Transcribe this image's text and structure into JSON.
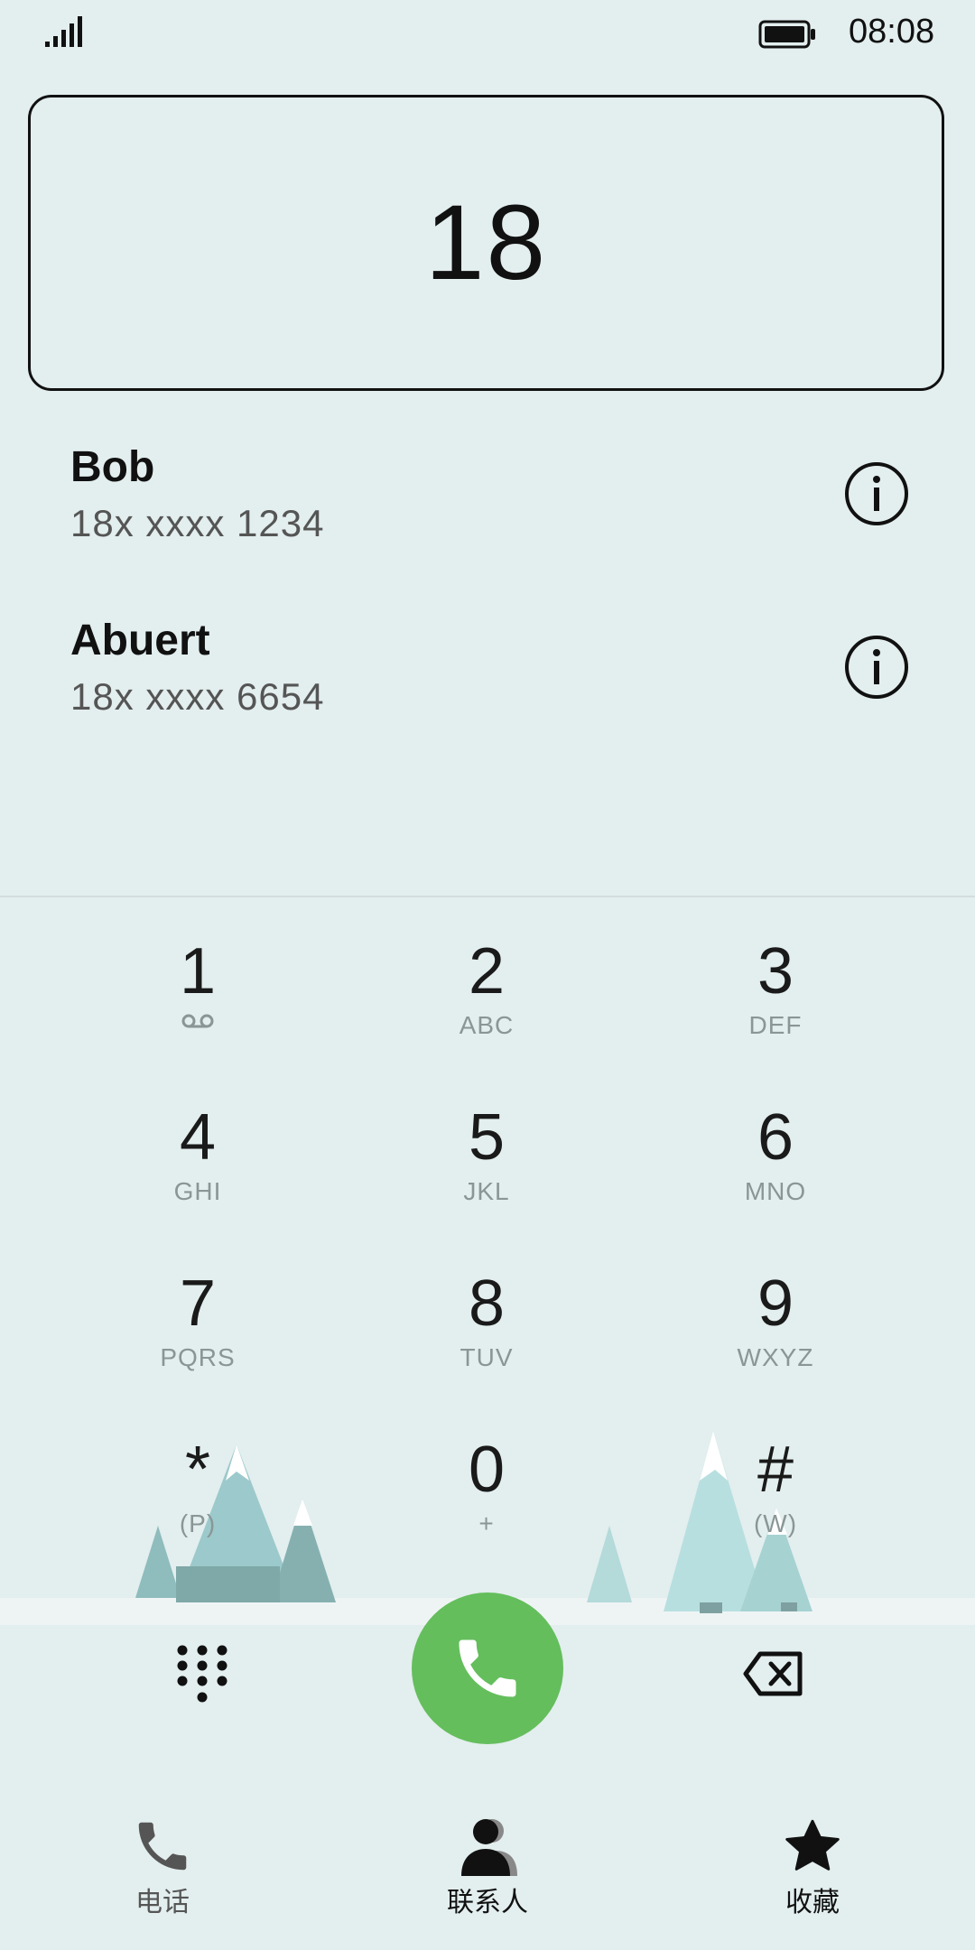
{
  "status_bar": {
    "time": "08:08"
  },
  "dialer": {
    "input": "18"
  },
  "suggestions": [
    {
      "name": "Bob",
      "number": "18x xxxx 1234"
    },
    {
      "name": "Abuert",
      "number": "18x xxxx 6654"
    }
  ],
  "keypad": [
    {
      "digit": "1",
      "sub": ""
    },
    {
      "digit": "2",
      "sub": "ABC"
    },
    {
      "digit": "3",
      "sub": "DEF"
    },
    {
      "digit": "4",
      "sub": "GHI"
    },
    {
      "digit": "5",
      "sub": "JKL"
    },
    {
      "digit": "6",
      "sub": "MNO"
    },
    {
      "digit": "7",
      "sub": "PQRS"
    },
    {
      "digit": "8",
      "sub": "TUV"
    },
    {
      "digit": "9",
      "sub": "WXYZ"
    },
    {
      "digit": "*",
      "sub": "(P)"
    },
    {
      "digit": "0",
      "sub": "+"
    },
    {
      "digit": "#",
      "sub": "(W)"
    }
  ],
  "bottom_nav": [
    {
      "label": "电话",
      "icon": "phone-icon"
    },
    {
      "label": "联系人",
      "icon": "contacts-icon"
    },
    {
      "label": "收藏",
      "icon": "star-icon"
    }
  ],
  "colors": {
    "call": "#64be5c",
    "background": "#e3eeee",
    "nav_inactive": "#555555"
  }
}
